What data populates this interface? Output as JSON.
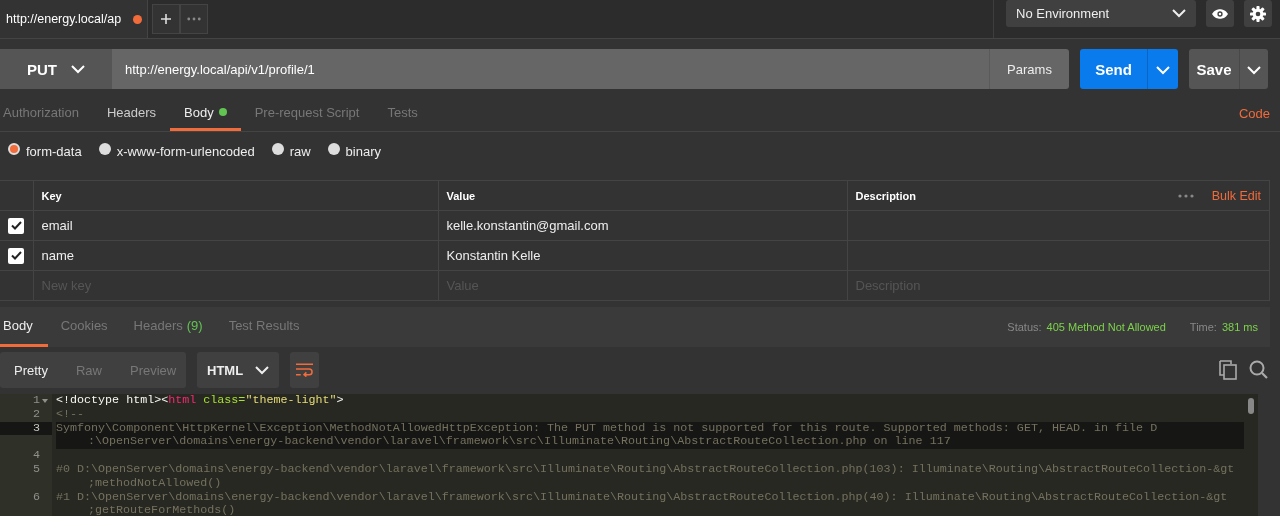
{
  "tabs": [
    {
      "label": "http://energy.local/ap",
      "unsaved": true,
      "selected": true
    }
  ],
  "environment": {
    "value": "No Environment"
  },
  "request": {
    "method": "PUT",
    "url": "http://energy.local/api/v1/profile/1",
    "params_label": "Params",
    "send_label": "Send",
    "save_label": "Save"
  },
  "request_tabs": [
    {
      "label": "Authorization",
      "selected": false,
      "indicator": false
    },
    {
      "label": "Headers",
      "selected": false,
      "indicator": false
    },
    {
      "label": "Body",
      "selected": true,
      "indicator": true
    },
    {
      "label": "Pre-request Script",
      "selected": false,
      "indicator": false
    },
    {
      "label": "Tests",
      "selected": false,
      "indicator": false
    }
  ],
  "code_link": "Code",
  "body_modes": [
    {
      "label": "form-data",
      "selected": true
    },
    {
      "label": "x-www-form-urlencoded",
      "selected": false
    },
    {
      "label": "raw",
      "selected": false
    },
    {
      "label": "binary",
      "selected": false
    }
  ],
  "params_table": {
    "columns": [
      "Key",
      "Value",
      "Description"
    ],
    "bulk_edit": "Bulk Edit",
    "rows": [
      {
        "checked": true,
        "key": "email",
        "value": "kelle.konstantin@gmail.com"
      },
      {
        "checked": true,
        "key": "name",
        "value": "Konstantin Kelle"
      }
    ],
    "new_row": {
      "key_placeholder": "New key",
      "value_placeholder": "Value",
      "description_placeholder": "Description"
    }
  },
  "response_tabs": [
    {
      "label": "Body",
      "selected": true
    },
    {
      "label": "Cookies",
      "selected": false
    },
    {
      "label": "Headers",
      "count": "(9)",
      "selected": false
    },
    {
      "label": "Test Results",
      "selected": false
    }
  ],
  "status": {
    "status_label": "Status:",
    "status_value": "405 Method Not Allowed",
    "time_label": "Time:",
    "time_value": "381 ms"
  },
  "view_modes": [
    {
      "label": "Pretty",
      "selected": true
    },
    {
      "label": "Raw",
      "selected": false
    },
    {
      "label": "Preview",
      "selected": false
    }
  ],
  "format": "HTML",
  "wrap_on": true,
  "code": {
    "lines": [
      {
        "number": "1",
        "foldable": true,
        "active": false,
        "tokens": [
          {
            "kind": "plain",
            "text": "<!doctype html><"
          },
          {
            "kind": "tag",
            "text": "html"
          },
          {
            "kind": "attr",
            "text": " class="
          },
          {
            "kind": "string",
            "text": "\"theme-light\""
          },
          {
            "kind": "plain",
            "text": ">"
          }
        ]
      },
      {
        "number": "2",
        "foldable": false,
        "active": false,
        "tokens": [
          {
            "kind": "comment",
            "text": "<!--"
          }
        ]
      },
      {
        "number": "3",
        "foldable": false,
        "active": true,
        "tokens": [
          {
            "kind": "comment",
            "text": "Symfony\\Component\\HttpKernel\\Exception\\MethodNotAllowedHttpException: The PUT method is not supported for this route. Supported methods: GET, HEAD. in file D"
          }
        ],
        "wrap": ":\\OpenServer\\domains\\energy-backend\\vendor\\laravel\\framework\\src\\Illuminate\\Routing\\AbstractRouteCollection.php on line 117"
      },
      {
        "number": "4",
        "foldable": false,
        "active": false
      },
      {
        "number": "5",
        "foldable": false,
        "active": false,
        "tokens": [
          {
            "kind": "comment",
            "text": "#0 D:\\OpenServer\\domains\\energy-backend\\vendor\\laravel\\framework\\src\\Illuminate\\Routing\\AbstractRouteCollection.php(103): Illuminate\\Routing\\AbstractRouteCollection-&gt"
          }
        ],
        "wrap": ";methodNotAllowed()"
      },
      {
        "number": "6",
        "foldable": false,
        "active": false,
        "tokens": [
          {
            "kind": "comment",
            "text": "#1 D:\\OpenServer\\domains\\energy-backend\\vendor\\laravel\\framework\\src\\Illuminate\\Routing\\AbstractRouteCollection.php(40): Illuminate\\Routing\\AbstractRouteCollection-&gt"
          }
        ],
        "wrap": ";getRouteForMethods()"
      }
    ]
  }
}
